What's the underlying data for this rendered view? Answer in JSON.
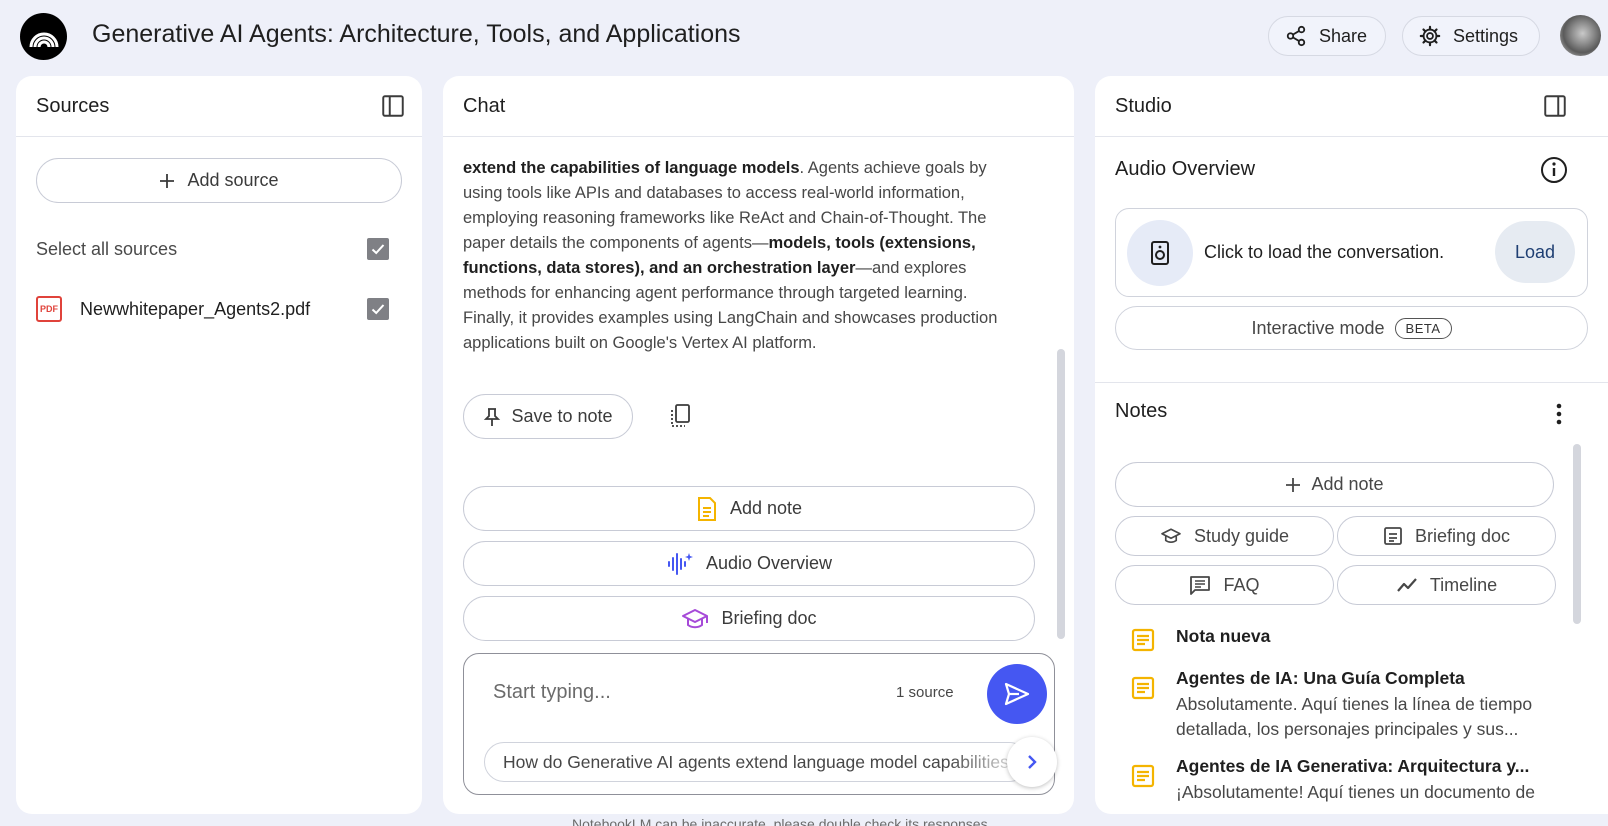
{
  "header": {
    "title": "Generative AI Agents: Architecture, Tools, and Applications",
    "share_label": "Share",
    "settings_label": "Settings"
  },
  "sources": {
    "title": "Sources",
    "add_source_label": "Add source",
    "select_all_label": "Select all sources",
    "items": [
      {
        "type_badge": "PDF",
        "name": "Newwhitepaper_Agents2.pdf",
        "checked": true
      }
    ],
    "select_all_checked": true
  },
  "chat": {
    "title": "Chat",
    "message": {
      "p1_bold": "extend the capabilities of language models",
      "p2": ". Agents achieve goals by using tools like APIs and databases to access real-world information, employing reasoning frameworks like ReAct and Chain-of-Thought. The paper details the components of agents—",
      "p3_bold": "models, tools (extensions, functions, data stores), and an orchestration layer",
      "p4": "—and explores methods for enhancing agent performance through targeted learning. Finally, it provides examples using LangChain and showcases production applications built on Google's Vertex AI platform."
    },
    "save_to_note_label": "Save to note",
    "suggestions": [
      "Add note",
      "Audio Overview",
      "Briefing doc"
    ],
    "input_placeholder": "Start typing...",
    "source_count": "1 source",
    "suggested_question": "How do Generative AI agents extend language model capabilities?",
    "footer_note": "NotebookLM can be inaccurate, please double check its responses."
  },
  "studio": {
    "title": "Studio",
    "audio_overview": {
      "title": "Audio Overview",
      "prompt": "Click to load the conversation.",
      "load_label": "Load",
      "interactive_label": "Interactive mode",
      "badge": "BETA"
    },
    "notes": {
      "title": "Notes",
      "add_note_label": "Add note",
      "chips": [
        "Study guide",
        "Briefing doc",
        "FAQ",
        "Timeline"
      ],
      "items": [
        {
          "title": "Nota nueva",
          "body": ""
        },
        {
          "title": "Agentes de IA: Una Guía Completa",
          "body": "Absolutamente. Aquí tienes la línea de tiempo detallada, los personajes principales y sus..."
        },
        {
          "title": "Agentes de IA Generativa: Arquitectura y...",
          "body": "¡Absolutamente! Aquí tienes un documento de"
        }
      ]
    }
  },
  "colors": {
    "accent_blue": "#4557f2",
    "page_bg": "#eef0f9",
    "note_icon": "#f4b400",
    "pdf_red": "#e0433b"
  },
  "icons": [
    "logo-icon",
    "share-icon",
    "gear-icon",
    "panel-toggle-icon",
    "plus-icon",
    "checkbox-icon",
    "pdf-icon",
    "pin-icon",
    "copy-icon",
    "note-doc-icon",
    "audio-waveform-icon",
    "graduation-cap-icon",
    "send-icon",
    "chevron-right-icon",
    "info-icon",
    "speaker-icon",
    "kebab-icon",
    "briefing-icon",
    "faq-icon",
    "timeline-icon"
  ]
}
